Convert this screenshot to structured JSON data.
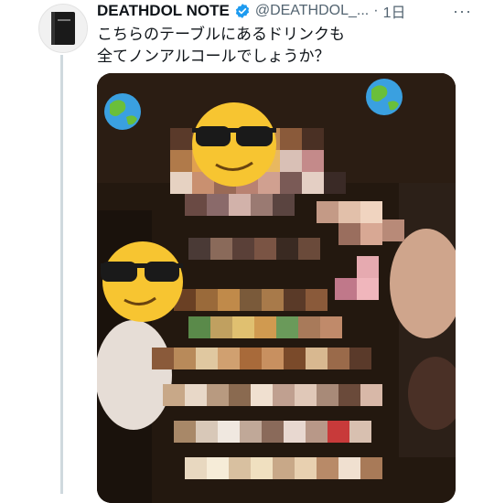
{
  "tweet": {
    "author_name": "DEATHDOL NOTE",
    "handle": "@DEATHDOL_...",
    "separator": "·",
    "time": "1日",
    "text_line1": "こちらのテーブルにあるドリンクも",
    "text_line2": "全てノンアルコールでしょうか？",
    "more_label": "···"
  },
  "icons": {
    "avatar": "notebook-icon",
    "verified": "verified-badge-icon",
    "globe": "globe-icon",
    "sunglasses_emoji": "sunglasses-emoji-icon"
  },
  "colors": {
    "verified": "#1d9bf0",
    "name": "#0f1419",
    "secondary": "#536471",
    "thread_line": "#cfd9de"
  }
}
